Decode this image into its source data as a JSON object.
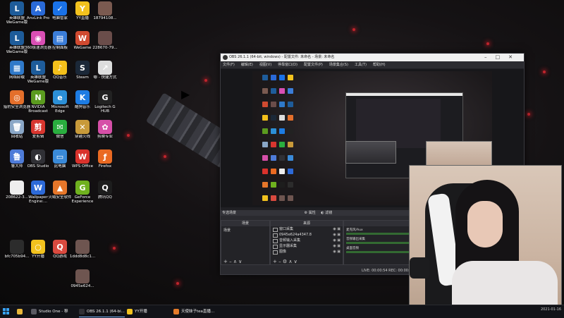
{
  "desktop": {
    "icons": [
      {
        "label": "英雄联盟WeGame版",
        "color": "#1e5c9a",
        "glyph": "L"
      },
      {
        "label": "AnvLink Pro",
        "color": "#2a6ad8",
        "glyph": "A"
      },
      {
        "label": "电脑管家",
        "color": "#1a72e8",
        "glyph": "✓"
      },
      {
        "label": "YY直播",
        "color": "#f2c21e",
        "glyph": "Y"
      },
      {
        "label": "18794108...",
        "color": "#7a5a50",
        "glyph": ""
      },
      {
        "label": "英雄联盟WeGame版",
        "color": "#1e5c9a",
        "glyph": "L"
      },
      {
        "label": "360极速浏览器",
        "color": "#d94fb4",
        "glyph": "◉"
      },
      {
        "label": "控制面板",
        "color": "#3b7dd8",
        "glyph": "▤"
      },
      {
        "label": "WeGame",
        "color": "#d04a30",
        "glyph": "W"
      },
      {
        "label": "228670-79...",
        "color": "#6a4d4a",
        "glyph": ""
      },
      {
        "label": "网络卸载",
        "color": "#2f79c9",
        "glyph": "▦"
      },
      {
        "label": "英雄联盟WeGame版",
        "color": "#1e5c9a",
        "glyph": "L"
      },
      {
        "label": "QQ音乐",
        "color": "#f4c01b",
        "glyph": "♪"
      },
      {
        "label": "Steam",
        "color": "#1b2838",
        "glyph": "S"
      },
      {
        "label": "哪 - 快捷方式",
        "color": "#dddddd",
        "glyph": "↗"
      },
      {
        "label": "猎豹安全浏览器",
        "color": "#e46f2b",
        "glyph": "◎"
      },
      {
        "label": "NVIDIA Broadcast",
        "color": "#5b9b1f",
        "glyph": "N"
      },
      {
        "label": "Microsoft Edge",
        "color": "#2c8fd6",
        "glyph": "e"
      },
      {
        "label": "酷狗音乐",
        "color": "#1d7ce3",
        "glyph": "K"
      },
      {
        "label": "Logitech G HUB",
        "color": "#222222",
        "glyph": "G"
      },
      {
        "label": "回收站",
        "color": "#8aa7c7",
        "glyph": "🗑"
      },
      {
        "label": "爱剪辑",
        "color": "#d8362f",
        "glyph": "剪"
      },
      {
        "label": "微信",
        "color": "#2aae3f",
        "glyph": "✉"
      },
      {
        "label": "穿越火线",
        "color": "#c89a3a",
        "glyph": "✕"
      },
      {
        "label": "剪映专业",
        "color": "#d64fa8",
        "glyph": "✿"
      },
      {
        "label": "鲁大师",
        "color": "#4e7bd8",
        "glyph": "鲁"
      },
      {
        "label": "OBS Studio",
        "color": "#303035",
        "glyph": "◐"
      },
      {
        "label": "此电脑",
        "color": "#3a8ad8",
        "glyph": "▭"
      },
      {
        "label": "WPS Office",
        "color": "#d9322c",
        "glyph": "W"
      },
      {
        "label": "Firefox",
        "color": "#ea6a22",
        "glyph": "ƒ"
      },
      {
        "label": "208622-3...",
        "color": "#eeeeee",
        "glyph": ""
      },
      {
        "label": "Wallpaper Engine:...",
        "color": "#2d6ad8",
        "glyph": "W"
      },
      {
        "label": "火绒安全软件",
        "color": "#e5762a",
        "glyph": "▲"
      },
      {
        "label": "GeForce Experience",
        "color": "#6fb11f",
        "glyph": "G"
      },
      {
        "label": "腾讯QQ",
        "color": "#1d1d1d",
        "glyph": "Q"
      },
      {
        "label": "bfc705b94...",
        "color": "#2c2c2c",
        "glyph": ""
      },
      {
        "label": "YY开播",
        "color": "#f2c21e",
        "glyph": "○"
      },
      {
        "label": "QQ游戏",
        "color": "#d94a3f",
        "glyph": "Q"
      },
      {
        "label": "1ddd8d8c1...",
        "color": "#6e5550",
        "glyph": ""
      },
      {
        "label": "0945e624...",
        "color": "#6e5550",
        "glyph": ""
      }
    ]
  },
  "obs": {
    "title": "OBS 26.1.1 (64-bit, windows) - 配置文件: 未命名 - 场景: 未命名",
    "menu": [
      "文件(F)",
      "编辑(E)",
      "视图(V)",
      "停靠窗口(D)",
      "配置文件(P)",
      "场景集合(S)",
      "工具(T)",
      "帮助(H)"
    ],
    "transition_label": "专选场景",
    "props_button": "属性",
    "filter_button": "滤镜",
    "scenes_header": "场景",
    "scene_name": "场景",
    "sources_header": "来源",
    "sources": [
      "窗口采集",
      "0945e624a4347.8",
      "音频输入采集",
      "显示器采集",
      "图像"
    ],
    "mixer_header": "混音器",
    "mixer": [
      "麦克风/Aux",
      "音频输出采集",
      "桌面音频"
    ],
    "status": "LIVE: 00:00:54   REC: 00:00:00   CPU: 4.8%, 60.00 fps"
  },
  "taskbar": {
    "items": [
      {
        "label": "Studio One - 穆",
        "color": "#5a5a62"
      },
      {
        "label": "OBS 26.1.1 (64-bi...",
        "color": "#303035"
      },
      {
        "label": "YY开播",
        "color": "#f2c21e"
      },
      {
        "label": "天使妹子tea直播...",
        "color": "#e47b2a"
      }
    ],
    "clock": "2021-01-16"
  }
}
